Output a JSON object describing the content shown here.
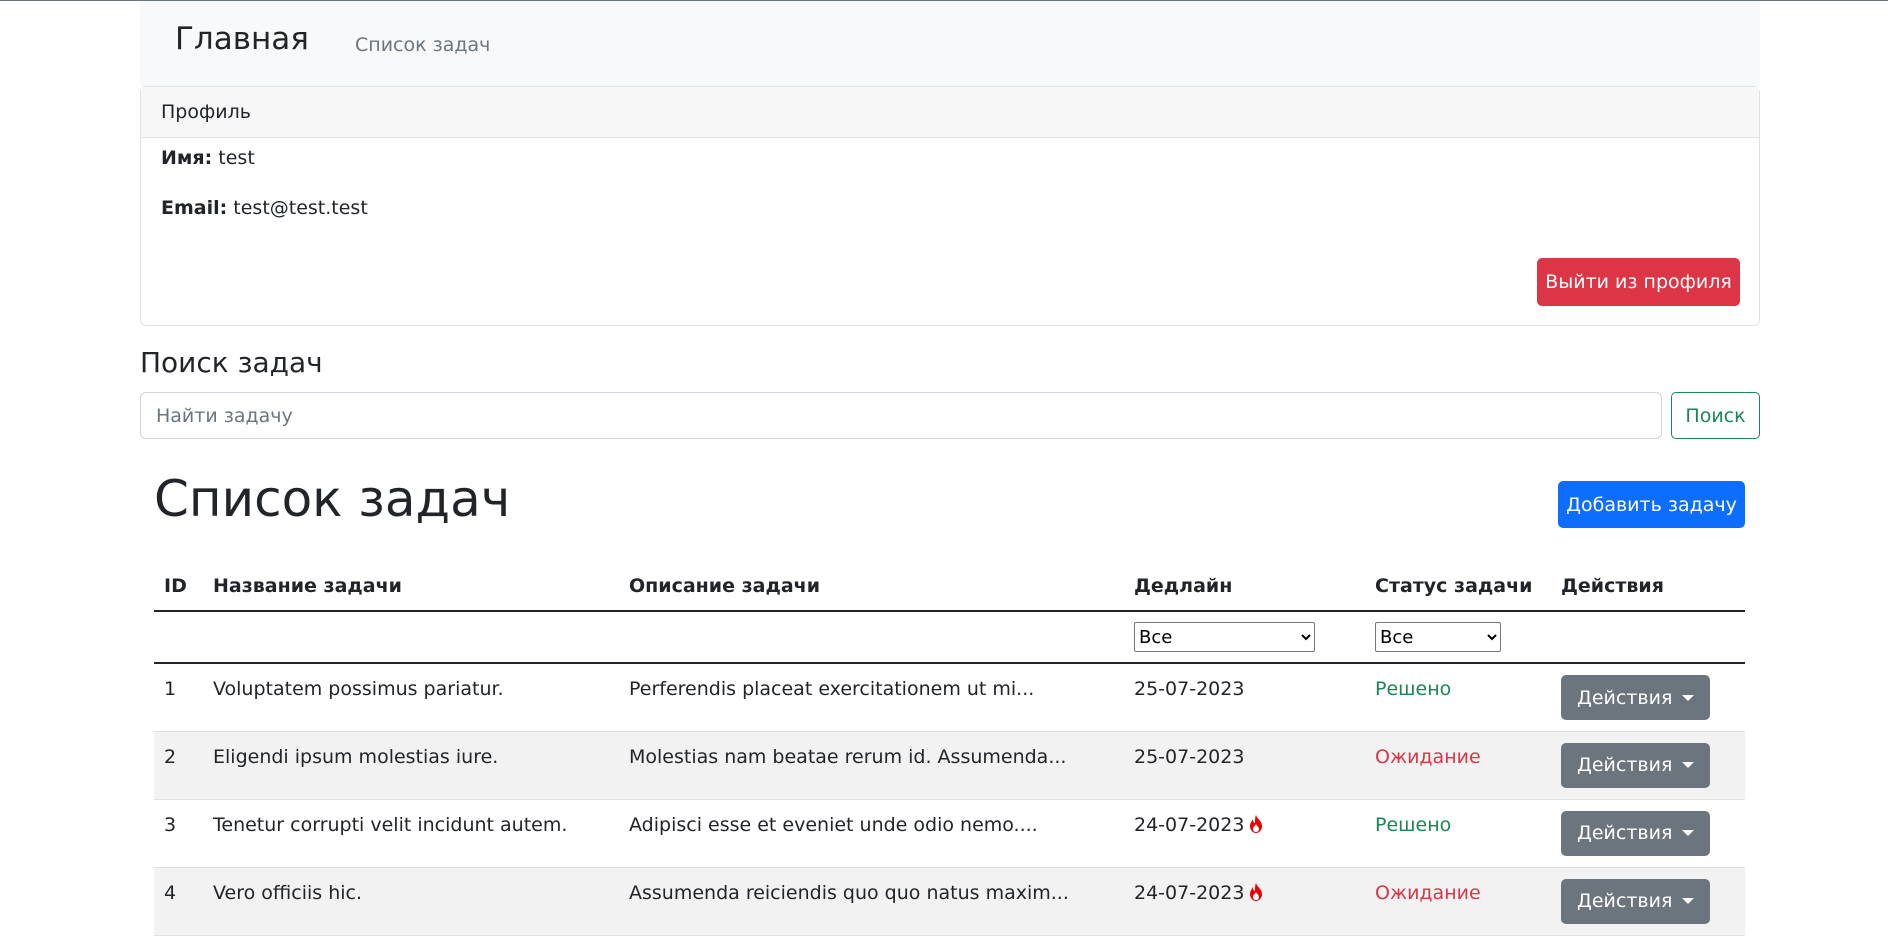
{
  "navbar": {
    "brand": "Главная",
    "link": "Список задач"
  },
  "profile": {
    "header": "Профиль",
    "name_label": "Имя:",
    "name_value": "test",
    "email_label": "Email:",
    "email_value": "test@test.test",
    "logout_label": "Выйти из профиля"
  },
  "search": {
    "heading": "Поиск задач",
    "placeholder": "Найти задачу",
    "button_label": "Поиск"
  },
  "tasks": {
    "heading": "Список задач",
    "add_label": "Добавить задачу",
    "columns": [
      "ID",
      "Название задачи",
      "Описание задачи",
      "Дедлайн",
      "Статус задачи",
      "Действия"
    ],
    "filters": {
      "deadline": "Все",
      "status": "Все"
    },
    "rows": [
      {
        "id": "1",
        "title": "Voluptatem possimus pariatur.",
        "desc": "Perferendis placeat exercitationem ut mi...",
        "deadline": "25-07-2023",
        "urgent": false,
        "status": "Решено",
        "action": "Действия"
      },
      {
        "id": "2",
        "title": "Eligendi ipsum molestias iure.",
        "desc": "Molestias nam beatae rerum id. Assumenda...",
        "deadline": "25-07-2023",
        "urgent": false,
        "status": "Ожидание",
        "action": "Действия"
      },
      {
        "id": "3",
        "title": "Tenetur corrupti velit incidunt autem.",
        "desc": "Adipisci esse et eveniet unde odio nemo....",
        "deadline": "24-07-2023",
        "urgent": true,
        "status": "Решено",
        "action": "Действия"
      },
      {
        "id": "4",
        "title": "Vero officiis hic.",
        "desc": "Assumenda reiciendis quo quo natus maxim...",
        "deadline": "24-07-2023",
        "urgent": true,
        "status": "Ожидание",
        "action": "Действия"
      }
    ]
  },
  "colors": {
    "danger": "#dc3545",
    "primary": "#0d6efd",
    "success": "#198754",
    "secondary": "#6c757d"
  },
  "icons": {
    "urgent": "fire-icon",
    "dropdown": "caret-down-icon"
  }
}
